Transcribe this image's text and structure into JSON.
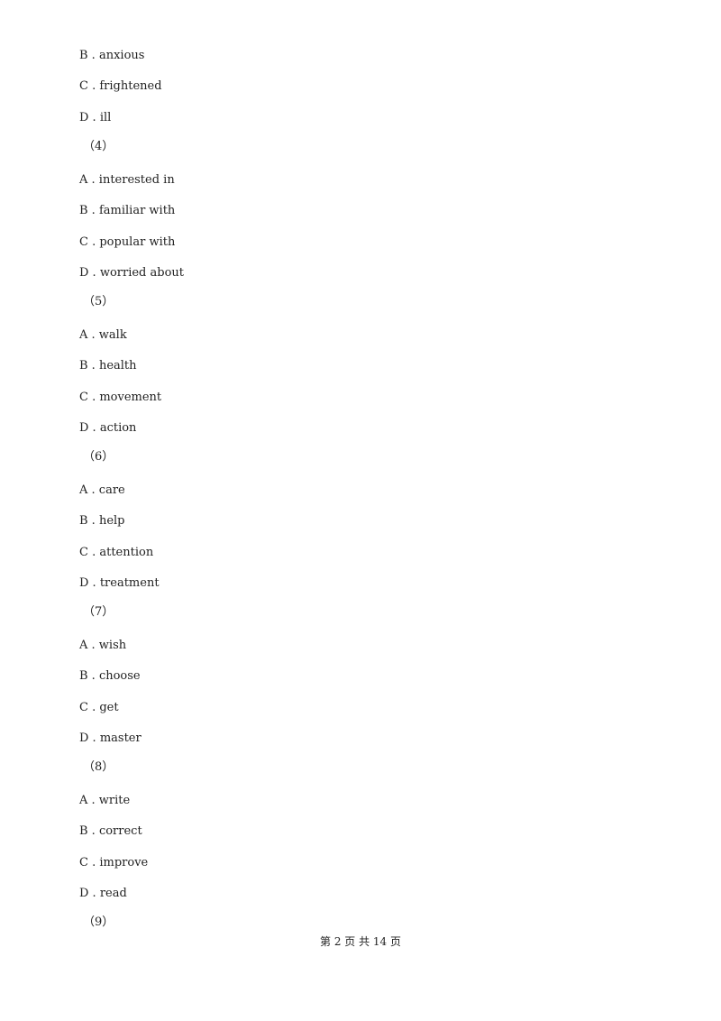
{
  "lines": [
    "B . anxious",
    "C . frightened",
    "D . ill",
    "（4）",
    "A . interested in",
    "B . familiar with",
    "C . popular with",
    "D . worried about",
    "（5）",
    "A . walk",
    "B . health",
    "C . movement",
    "D . action",
    "（6）",
    "A . care",
    "B . help",
    "C . attention",
    "D . treatment",
    "（7）",
    "A . wish",
    "B . choose",
    "C . get",
    "D . master",
    "（8）",
    "A . write",
    "B . correct",
    "C . improve",
    "D . read",
    "（9）"
  ],
  "footer": "第 2 页 共 14 页"
}
